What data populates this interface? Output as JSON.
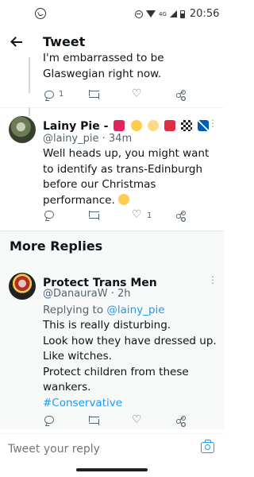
{
  "status_bar": {
    "time": "20:56",
    "network": "4G",
    "notification_icon": "whatsapp-icon"
  },
  "header": {
    "title": "Tweet",
    "back_icon": "back-arrow-icon"
  },
  "parent_tweet": {
    "text_line1": "I'm embarrassed to be",
    "text_line2": "Glaswegian right now.",
    "reply_count": "1",
    "retweet_count": "",
    "like_count": ""
  },
  "reply_tweet": {
    "name": "Lainy Pie -",
    "handle": "@lainy_pie",
    "dot": "·",
    "time": "34m",
    "text_lines": [
      "Well heads up, you might want",
      "to identify as trans-Edinburgh",
      "before our Christmas",
      "performance."
    ],
    "emoji_smile": "😉",
    "reply_count": "",
    "retweet_count": "",
    "like_count": "1"
  },
  "more_replies": {
    "title": "More Replies"
  },
  "protect_tweet": {
    "name": "Protect Trans Men",
    "handle": "@DanauraW",
    "dot": "·",
    "time": "2h",
    "replying_prefix": "Replying to",
    "replying_handle": "@lainy_pie",
    "text_lines": [
      "This is really disturbing.",
      "Look how they have dressed up.",
      "Like witches.",
      "Protect children from these",
      "wankers."
    ],
    "hashtag": "#Conservative"
  },
  "compose": {
    "placeholder": "Tweet your reply"
  },
  "colors": {
    "accent": "#1d9bf0",
    "text": "#0f1419",
    "muted": "#536471",
    "band": "#f7f9f9"
  }
}
